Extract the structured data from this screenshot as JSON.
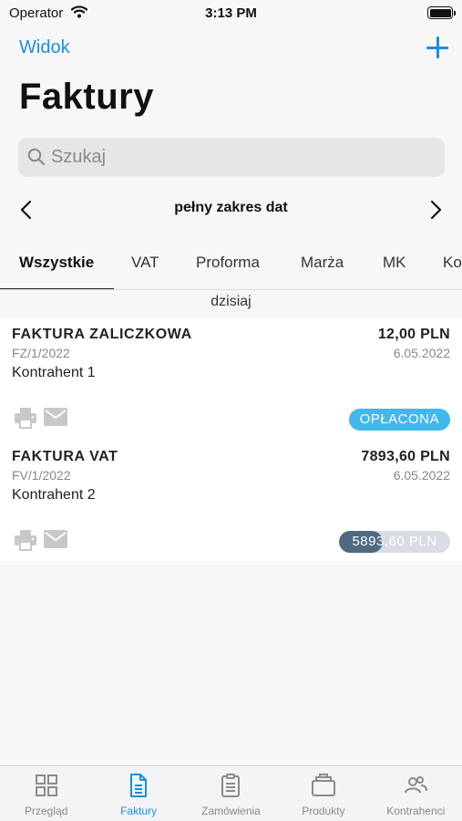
{
  "status_bar": {
    "carrier": "Operator",
    "time": "3:13 PM"
  },
  "nav": {
    "left_label": "Widok",
    "add_icon": "plus-icon"
  },
  "title": "Faktury",
  "search": {
    "placeholder": "Szukaj",
    "value": ""
  },
  "date_range": {
    "label": "pełny zakres dat"
  },
  "tabs": [
    {
      "label": "Wszystkie",
      "active": true
    },
    {
      "label": "VAT"
    },
    {
      "label": "Proforma"
    },
    {
      "label": "Marża"
    },
    {
      "label": "MK"
    },
    {
      "label": "Ko"
    }
  ],
  "day_header": "dzisiaj",
  "invoices": [
    {
      "title": "FAKTURA ZALICZKOWA",
      "number": "FZ/1/2022",
      "client": "Kontrahent 1",
      "amount": "12,00 PLN",
      "date": "6.05.2022",
      "status": "OPŁACONA",
      "status_color": "#42b8ea"
    },
    {
      "title": "FAKTURA VAT",
      "number": "FV/1/2022",
      "client": "Kontrahent 2",
      "amount": "7893,60 PLN",
      "date": "6.05.2022",
      "status": "5893,60 PLN",
      "paid_fraction": 0.39,
      "status_color": "#506a80"
    }
  ],
  "tabbar": [
    {
      "label": "Przegląd",
      "icon": "grid-icon"
    },
    {
      "label": "Faktury",
      "icon": "document-icon",
      "active": true
    },
    {
      "label": "Zamówienia",
      "icon": "clipboard-icon"
    },
    {
      "label": "Produkty",
      "icon": "briefcase-icon"
    },
    {
      "label": "Kontrahenci",
      "icon": "people-icon"
    }
  ],
  "colors": {
    "accent": "#1a8fe0",
    "paid_badge": "#42b8ea",
    "partial_bar": "#506a80"
  }
}
